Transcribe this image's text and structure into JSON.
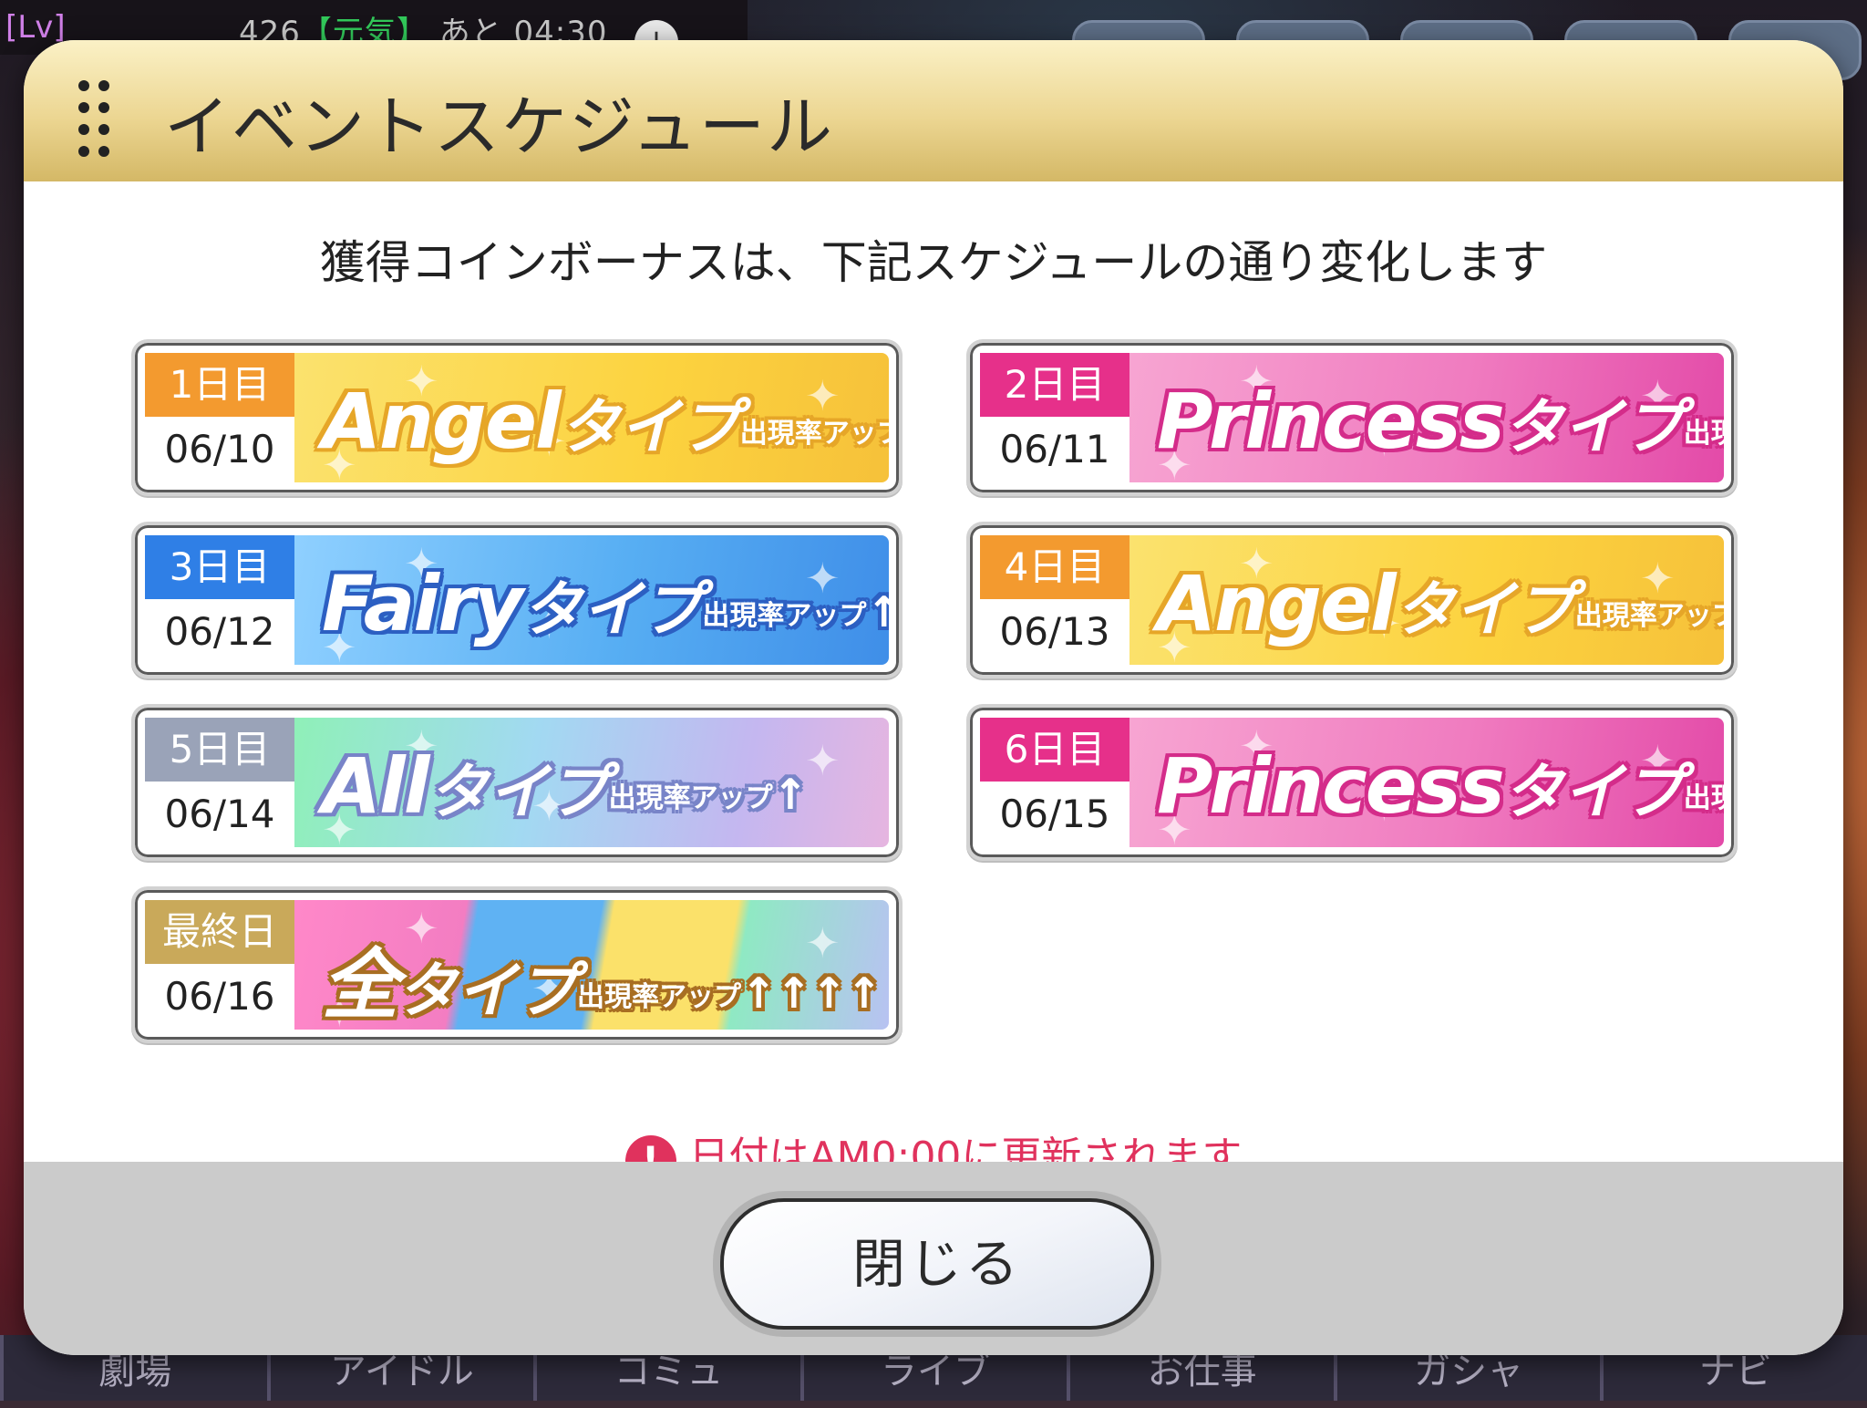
{
  "hud": {
    "level_label": "[Lv]",
    "stamina_value": "426",
    "stamina_tag": "【元気】",
    "stamina_timer": "あと 04:30",
    "plus_label": "+"
  },
  "dialog": {
    "title": "イベントスケジュール",
    "intro": "獲得コインボーナスは、下記スケジュールの通り変化します",
    "notice": "日付はAM0:00に更新されます",
    "notice_icon": "!",
    "close_label": "閉じる"
  },
  "schedule": [
    {
      "day": "1日目",
      "date": "06/10",
      "type_name": "Angel",
      "type_suffix": "タイプ",
      "rate_text": "出現率アップ",
      "arrows": "↑",
      "badge_color": "#f39a2f",
      "theme": "angel"
    },
    {
      "day": "2日目",
      "date": "06/11",
      "type_name": "Princess",
      "type_suffix": "タイプ",
      "rate_text": "出現率アップ",
      "arrows": "↑",
      "badge_color": "#e6308a",
      "theme": "princess"
    },
    {
      "day": "3日目",
      "date": "06/12",
      "type_name": "Fairy",
      "type_suffix": "タイプ",
      "rate_text": "出現率アップ",
      "arrows": "↑",
      "badge_color": "#2f7fe6",
      "theme": "fairy"
    },
    {
      "day": "4日目",
      "date": "06/13",
      "type_name": "Angel",
      "type_suffix": "タイプ",
      "rate_text": "出現率アップ",
      "arrows": "↑",
      "badge_color": "#f39a2f",
      "theme": "angel"
    },
    {
      "day": "5日目",
      "date": "06/14",
      "type_name": "All",
      "type_suffix": "タイプ",
      "rate_text": "出現率アップ",
      "arrows": "↑",
      "badge_color": "#9aa3b8",
      "theme": "all"
    },
    {
      "day": "6日目",
      "date": "06/15",
      "type_name": "Princess",
      "type_suffix": "タイプ",
      "rate_text": "出現率アップ",
      "arrows": "↑",
      "badge_color": "#e6308a",
      "theme": "princess"
    },
    {
      "day": "最終日",
      "date": "06/16",
      "type_name": "全",
      "type_suffix": "タイプ",
      "rate_text": "出現率アップ",
      "arrows": "↑↑↑↑",
      "badge_color": "#c9a95a",
      "theme": "full"
    }
  ],
  "bottom_nav": [
    "劇場",
    "アイドル",
    "コミュ",
    "ライブ",
    "お仕事",
    "ガシャ",
    "ナビ"
  ]
}
